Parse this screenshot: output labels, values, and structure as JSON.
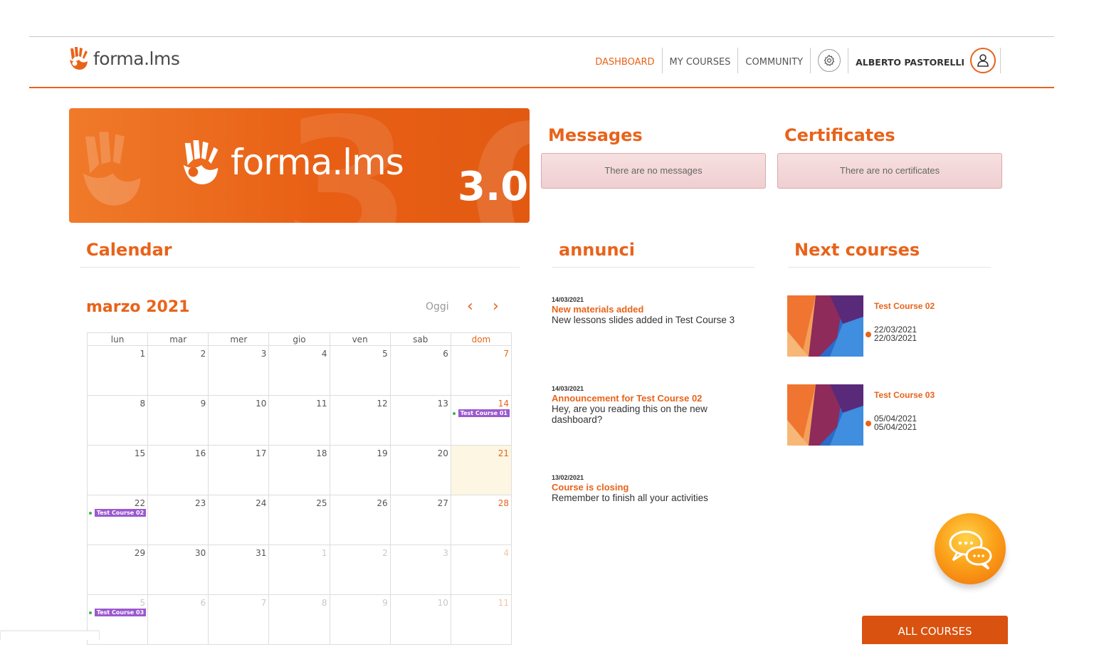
{
  "brand": {
    "name": "forma.lms",
    "banner_version": "3.0"
  },
  "nav": {
    "dashboard": "DASHBOARD",
    "my_courses": "MY COURSES",
    "community": "COMMUNITY",
    "user": "ALBERTO PASTORELLI"
  },
  "messages": {
    "title": "Messages",
    "empty": "There are no messages"
  },
  "certificates": {
    "title": "Certificates",
    "empty": "There are no certificates"
  },
  "calendar": {
    "title": "Calendar",
    "month": "marzo 2021",
    "today_label": "Oggi",
    "prev": "‹",
    "next": "›",
    "weekdays": [
      "lun",
      "mar",
      "mer",
      "gio",
      "ven",
      "sab",
      "dom"
    ],
    "weeks": [
      [
        {
          "n": "1"
        },
        {
          "n": "2"
        },
        {
          "n": "3"
        },
        {
          "n": "4"
        },
        {
          "n": "5"
        },
        {
          "n": "6"
        },
        {
          "n": "7"
        }
      ],
      [
        {
          "n": "8"
        },
        {
          "n": "9"
        },
        {
          "n": "10"
        },
        {
          "n": "11"
        },
        {
          "n": "12"
        },
        {
          "n": "13"
        },
        {
          "n": "14",
          "event": "Test Course 01"
        }
      ],
      [
        {
          "n": "15"
        },
        {
          "n": "16"
        },
        {
          "n": "17"
        },
        {
          "n": "18"
        },
        {
          "n": "19"
        },
        {
          "n": "20"
        },
        {
          "n": "21",
          "today": true
        }
      ],
      [
        {
          "n": "22",
          "event": "Test Course 02"
        },
        {
          "n": "23"
        },
        {
          "n": "24"
        },
        {
          "n": "25"
        },
        {
          "n": "26"
        },
        {
          "n": "27"
        },
        {
          "n": "28"
        }
      ],
      [
        {
          "n": "29"
        },
        {
          "n": "30"
        },
        {
          "n": "31"
        },
        {
          "n": "1",
          "other": true
        },
        {
          "n": "2",
          "other": true
        },
        {
          "n": "3",
          "other": true
        },
        {
          "n": "4",
          "other": true
        }
      ],
      [
        {
          "n": "5",
          "other": true,
          "event": "Test Course 03"
        },
        {
          "n": "6",
          "other": true
        },
        {
          "n": "7",
          "other": true
        },
        {
          "n": "8",
          "other": true
        },
        {
          "n": "9",
          "other": true
        },
        {
          "n": "10",
          "other": true
        },
        {
          "n": "11",
          "other": true
        }
      ]
    ]
  },
  "announcements": {
    "title": "annunci",
    "items": [
      {
        "date": "14/03/2021",
        "title": "New materials added",
        "body": "New lessons slides added in Test Course 3"
      },
      {
        "date": "14/03/2021",
        "title": "Announcement for Test Course 02",
        "body": "Hey, are you reading this on the new dashboard?"
      },
      {
        "date": "13/02/2021",
        "title": "Course is closing",
        "body": "Remember to finish all your activities"
      }
    ]
  },
  "next_courses": {
    "title": "Next courses",
    "items": [
      {
        "name": "Test Course 02",
        "start": "22/03/2021",
        "end": "22/03/2021"
      },
      {
        "name": "Test Course 03",
        "start": "05/04/2021",
        "end": "05/04/2021"
      }
    ]
  },
  "all_courses_label": "ALL COURSES",
  "icons": {
    "logo": "hand-logo-icon",
    "settings": "gear-icon",
    "user": "user-icon",
    "chat": "chat-bubbles-icon"
  },
  "colors": {
    "accent": "#e8631a",
    "event": "#9b59d0",
    "today": "#fcf6e3"
  }
}
